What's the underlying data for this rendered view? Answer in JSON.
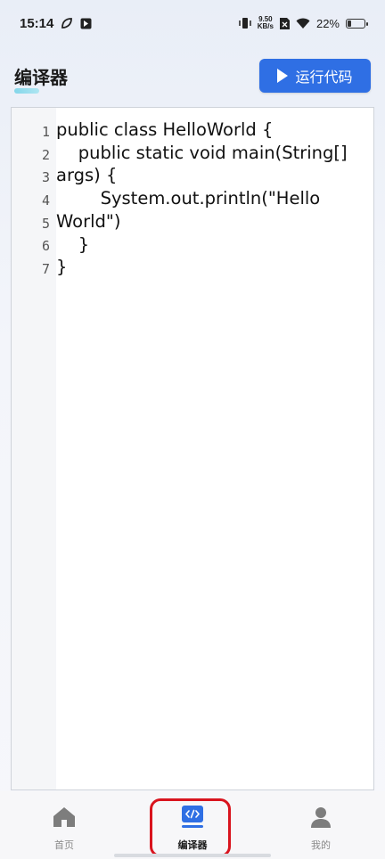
{
  "status_bar": {
    "time": "15:14",
    "net_speed_value": "9.50",
    "net_speed_unit": "KB/s",
    "battery_percent": "22%",
    "battery_level": 0.22
  },
  "header": {
    "title": "编译器",
    "run_button_label": "运行代码"
  },
  "editor": {
    "line_numbers": [
      "1",
      "2",
      "3",
      "4",
      "5",
      "6",
      "7"
    ],
    "code": "public class HelloWorld {\n    public static void main(String[] args) {\n        System.out.println(\"Hello World\")\n    }\n}"
  },
  "bottom_nav": {
    "items": [
      {
        "label": "首页",
        "icon": "home-icon",
        "active": false
      },
      {
        "label": "编译器",
        "icon": "code-icon",
        "active": true
      },
      {
        "label": "我的",
        "icon": "user-icon",
        "active": false
      }
    ]
  },
  "colors": {
    "accent": "#2f6fe4",
    "highlight_border": "#d9141e"
  }
}
